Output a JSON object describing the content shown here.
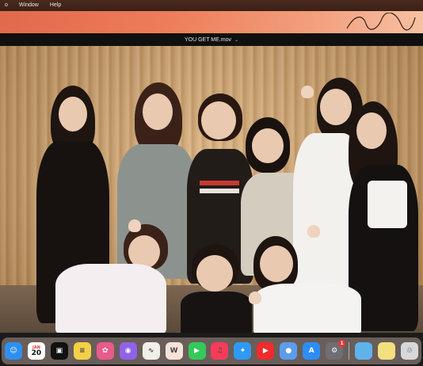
{
  "menubar": {
    "items": [
      "o",
      "Window",
      "Help"
    ]
  },
  "window": {
    "title": "YOU GET ME.mov",
    "title_chevron": "⌄"
  },
  "dock": {
    "apps": [
      {
        "name": "Finder",
        "icon": "finder-icon",
        "color": "#2f8ff0",
        "glyph": "☺"
      },
      {
        "name": "Calendar",
        "icon": "calendar-icon",
        "month": "JAN",
        "day": "20"
      },
      {
        "name": "Capture",
        "icon": "capture-icon",
        "color": "#111111",
        "glyph": "▣"
      },
      {
        "name": "Notes",
        "icon": "notes-icon",
        "color": "#f3d047",
        "glyph": "≡"
      },
      {
        "name": "Photos",
        "icon": "photos-icon",
        "color": "#e95b8a",
        "glyph": "✿"
      },
      {
        "name": "Shortcut",
        "icon": "shortcut-icon",
        "color": "#8f62e8",
        "glyph": "◉"
      },
      {
        "name": "Freeform",
        "icon": "freeform-icon",
        "color": "#f0efe8",
        "glyph": "∿"
      },
      {
        "name": "Word",
        "icon": "word-doc-icon",
        "color": "#f7e2da",
        "glyph": "W"
      },
      {
        "name": "FaceTime",
        "icon": "facetime-icon",
        "color": "#35c95a",
        "glyph": "▶"
      },
      {
        "name": "Music",
        "icon": "music-icon",
        "color": "#f53c5a",
        "glyph": "♫"
      },
      {
        "name": "Safari",
        "icon": "safari-icon",
        "color": "#2f9af5",
        "glyph": "✦"
      },
      {
        "name": "YouTube",
        "icon": "youtube-icon",
        "color": "#ef2b2b",
        "glyph": "▶"
      },
      {
        "name": "Chrome",
        "icon": "chrome-icon",
        "color": "#5c9ced",
        "glyph": "●"
      },
      {
        "name": "App Store",
        "icon": "app-store-icon",
        "color": "#2c8ef5",
        "glyph": "A"
      },
      {
        "name": "Settings",
        "icon": "settings-icon",
        "color": "#6e6e73",
        "glyph": "⚙",
        "badge": "1"
      }
    ],
    "trailing": [
      {
        "name": "Folder",
        "icon": "folder-icon",
        "color": "#5fb3ea",
        "glyph": ""
      },
      {
        "name": "Stickies",
        "icon": "stickies-icon",
        "color": "#f2df7e",
        "glyph": ""
      },
      {
        "name": "Trash",
        "icon": "trash-icon",
        "color": "#d6d8da",
        "glyph": "♲"
      }
    ]
  }
}
